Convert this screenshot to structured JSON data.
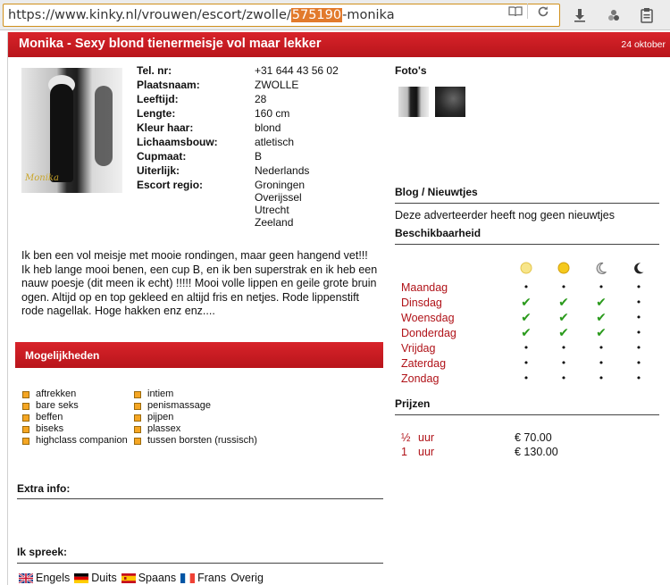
{
  "browser": {
    "url_prefix": "https://www.kinky.nl/vrouwen/escort/zwolle/",
    "url_highlight": "575190",
    "url_suffix": "-monika",
    "reader_icon": "reader-icon",
    "reload_icon": "reload-icon",
    "download_icon": "download-icon",
    "extension_icon": "extension-icon",
    "clipboard_icon": "clipboard-icon"
  },
  "header": {
    "title": "Monika - Sexy blond tienermeisje vol maar lekker",
    "date": "24 oktober"
  },
  "profile": {
    "photo_signature": "Monika",
    "fields": [
      {
        "label": "Tel. nr:",
        "value": "+31 644 43 56 02"
      },
      {
        "label": "Plaatsnaam:",
        "value": "ZWOLLE"
      },
      {
        "label": "Leeftijd:",
        "value": "28"
      },
      {
        "label": "Lengte:",
        "value": "160 cm"
      },
      {
        "label": "Kleur haar:",
        "value": "blond"
      },
      {
        "label": "Lichaamsbouw:",
        "value": "atletisch"
      },
      {
        "label": "Cupmaat:",
        "value": "B"
      },
      {
        "label": "Uiterlijk:",
        "value": "Nederlands"
      },
      {
        "label": "Escort regio:",
        "value": ""
      }
    ],
    "regions": [
      "Groningen",
      "Overijssel",
      "Utrecht",
      "Zeeland"
    ]
  },
  "description": "Ik ben een vol meisje met mooie rondingen, maar geen hangend vet!!! Ik heb lange mooi benen, een cup B, en ik ben superstrak en ik heb een nauw poesje (dit meen ik echt) !!!!! Mooi volle lippen en geile grote bruin ogen. Altijd op en top gekleed en altijd fris en netjes. Rode lippenstift rode nagellak. Hoge hakken enz enz....",
  "mogelijkheden": {
    "title": "Mogelijkheden",
    "col1": [
      "aftrekken",
      "bare seks",
      "beffen",
      "biseks",
      "highclass companion"
    ],
    "col2": [
      "intiem",
      "penismassage",
      "pijpen",
      "plassex",
      "tussen borsten (russisch)"
    ]
  },
  "extra_info": {
    "title": "Extra info:"
  },
  "languages": {
    "title": "Ik spreek:",
    "items": [
      {
        "label": "Engels",
        "flag": "flag-uk"
      },
      {
        "label": "Duits",
        "flag": "flag-de"
      },
      {
        "label": "Spaans",
        "flag": "flag-es"
      },
      {
        "label": "Frans",
        "flag": "flag-fr"
      },
      {
        "label": "Overig",
        "flag": ""
      }
    ]
  },
  "photos": {
    "title": "Foto's"
  },
  "blog": {
    "title": "Blog / Nieuwtjes",
    "text": "Deze adverteerder heeft nog geen nieuwtjes"
  },
  "availability": {
    "title": "Beschikbaarheid",
    "slot_icons": [
      "morning-sun-icon",
      "afternoon-sun-icon",
      "evening-moon-icon",
      "night-moon-icon"
    ],
    "days": [
      {
        "name": "Maandag",
        "slots": [
          false,
          false,
          false,
          false
        ]
      },
      {
        "name": "Dinsdag",
        "slots": [
          true,
          true,
          true,
          false
        ]
      },
      {
        "name": "Woensdag",
        "slots": [
          true,
          true,
          true,
          false
        ]
      },
      {
        "name": "Donderdag",
        "slots": [
          true,
          true,
          true,
          false
        ]
      },
      {
        "name": "Vrijdag",
        "slots": [
          false,
          false,
          false,
          false
        ]
      },
      {
        "name": "Zaterdag",
        "slots": [
          false,
          false,
          false,
          false
        ]
      },
      {
        "name": "Zondag",
        "slots": [
          false,
          false,
          false,
          false
        ]
      }
    ],
    "check_glyph": "✔",
    "dot_glyph": "•"
  },
  "prices": {
    "title": "Prijzen",
    "items": [
      {
        "qty": "½",
        "unit": "uur",
        "price": "€ 70.00"
      },
      {
        "qty": "1",
        "unit": "uur",
        "price": "€ 130.00"
      }
    ]
  }
}
